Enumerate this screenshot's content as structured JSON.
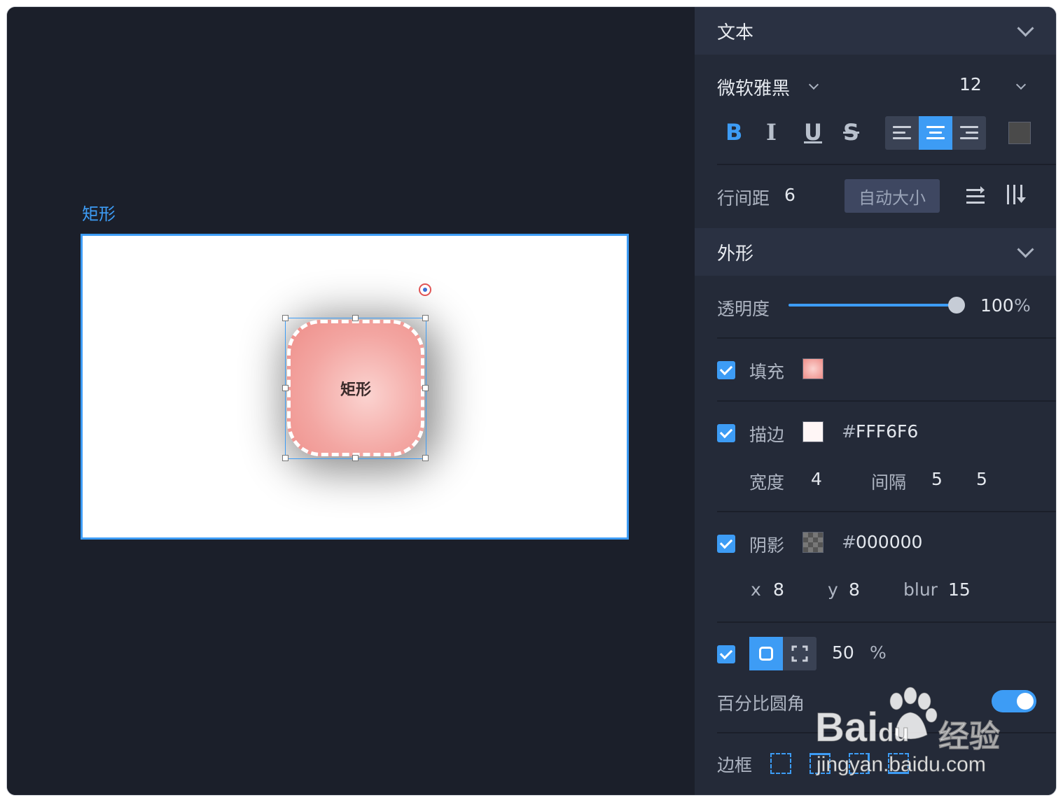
{
  "canvas": {
    "frame_label": "矩形",
    "shape_text": "矩形"
  },
  "panel": {
    "text_section": {
      "title": "文本",
      "font_family": "微软雅黑",
      "font_size": "12",
      "format_buttons": [
        "B",
        "I",
        "U",
        "S"
      ],
      "line_spacing_label": "行间距",
      "line_spacing_value": "6",
      "auto_size_label": "自动大小"
    },
    "shape_section": {
      "title": "外形",
      "opacity_label": "透明度",
      "opacity_value": "100",
      "opacity_unit": "%",
      "opacity_fraction": 1.0,
      "fill_label": "填充",
      "fill_color": "#f4a8a4",
      "stroke_label": "描边",
      "stroke_hash": "#",
      "stroke_color_hex": "FFF6F6",
      "stroke_width_label": "宽度",
      "stroke_width": "4",
      "stroke_gap_label": "间隔",
      "stroke_gap_1": "5",
      "stroke_gap_2": "5",
      "shadow_label": "阴影",
      "shadow_hash": "#",
      "shadow_color_hex": "000000",
      "shadow_x_label": "x",
      "shadow_x": "8",
      "shadow_y_label": "y",
      "shadow_y": "8",
      "shadow_blur_label": "blur",
      "shadow_blur": "15",
      "corner_value": "50",
      "corner_unit": "%",
      "percent_radius_label": "百分比圆角",
      "border_label": "边框"
    }
  },
  "watermark": {
    "brand": "Bai",
    "brand2": "du",
    "brand_cn": "经验",
    "url": "jingyan.baidu.com"
  },
  "colors": {
    "accent": "#3d9cf5",
    "panel_bg": "#242a38",
    "canvas_bg": "#1b1f2a"
  }
}
